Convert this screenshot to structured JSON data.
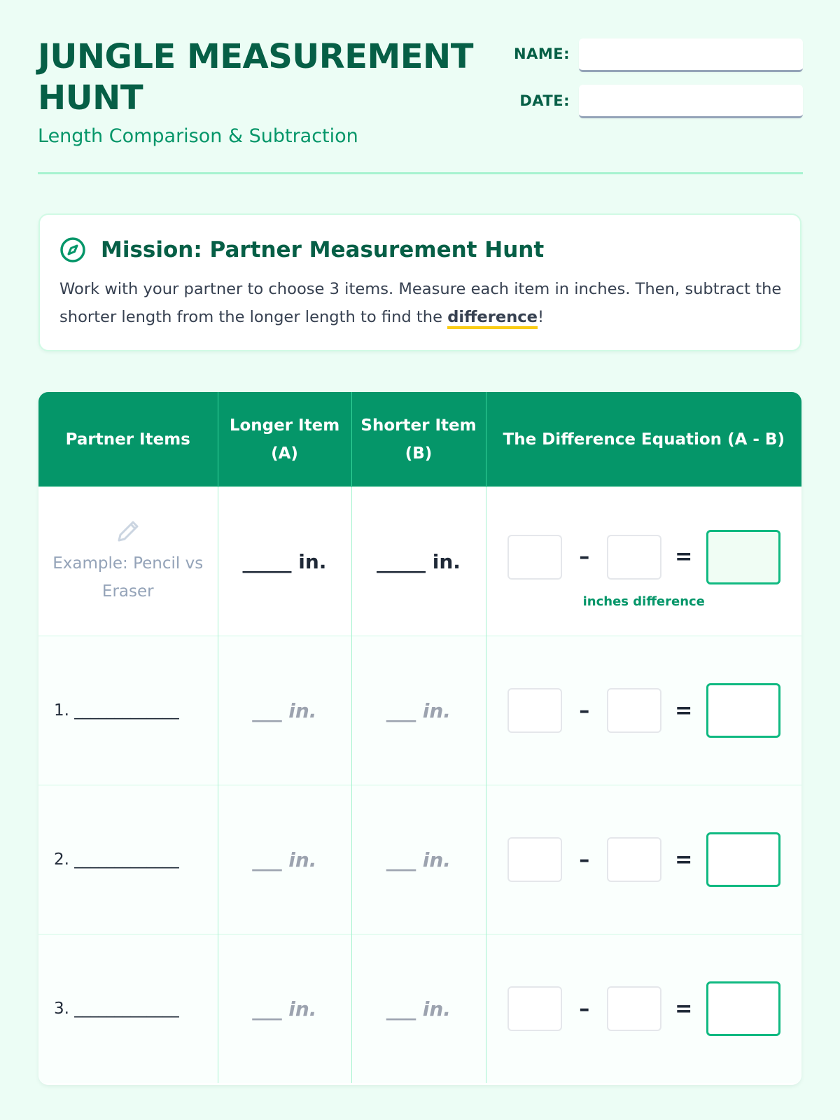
{
  "header": {
    "title": "JUNGLE MEASUREMENT HUNT",
    "subtitle": "Length Comparison & Subtraction",
    "name_label": "NAME:",
    "date_label": "DATE:"
  },
  "mission": {
    "icon": "compass-icon",
    "title": "Mission: Partner Measurement Hunt",
    "text_before": "Work with your partner to choose 3 items. Measure each item in inches. Then, subtract the shorter length from the longer length to find the ",
    "highlight": "difference",
    "text_after": "!"
  },
  "table": {
    "headers": [
      "Partner Items",
      "Longer Item (A)",
      "Shorter Item (B)",
      "The Difference Equation (A - B)"
    ],
    "example": {
      "icon": "pencil-icon",
      "label": "Example: Pencil vs Eraser",
      "longer": "_____ in.",
      "shorter": "_____ in.",
      "minus": "–",
      "equals": "=",
      "note": "inches difference"
    },
    "rows": [
      {
        "item": "1. _____________",
        "longer": "___ in.",
        "shorter": "___ in.",
        "minus": "–",
        "equals": "="
      },
      {
        "item": "2. _____________",
        "longer": "___ in.",
        "shorter": "___ in.",
        "minus": "–",
        "equals": "="
      },
      {
        "item": "3. _____________",
        "longer": "___ in.",
        "shorter": "___ in.",
        "minus": "–",
        "equals": "="
      }
    ]
  },
  "colors": {
    "page_bg": "#ecfdf5",
    "title": "#065f46",
    "accent": "#059669",
    "highlight": "#facc15"
  }
}
